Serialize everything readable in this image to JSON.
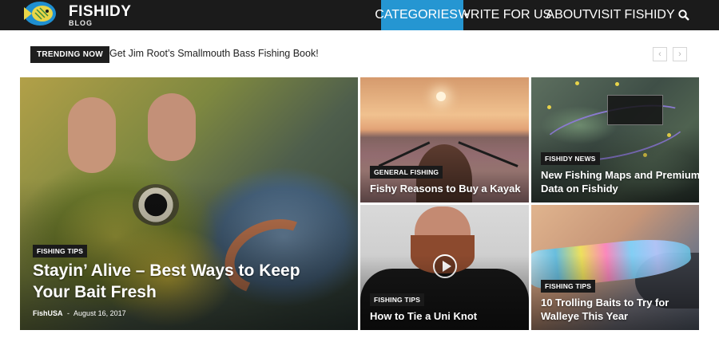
{
  "header": {
    "brand_name": "FISHIDY",
    "brand_sub": "BLOG",
    "nav": {
      "categories": "CATEGORIES",
      "write_for_us": "WRITE FOR US",
      "about": "ABOUT",
      "visit_fishidy": "VISIT FISHIDY"
    },
    "accent_color": "#2596d2"
  },
  "trending": {
    "label": "TRENDING NOW",
    "title": "Get Jim Root’s Smallmouth Bass Fishing Book!",
    "prev_glyph": "‹",
    "next_glyph": "›"
  },
  "featured": {
    "category": "FISHING TIPS",
    "title_line1": "Stayin’ Alive – Best Ways to Keep",
    "title_line2": "Your Bait Fresh",
    "author": "FishUSA",
    "separator": "-",
    "date": "August 16, 2017"
  },
  "tiles": [
    {
      "category": "GENERAL FISHING",
      "title_line1": "Fishy Reasons to Buy a Kayak",
      "title_line2": ""
    },
    {
      "category": "FISHIDY NEWS",
      "title_line1": "New Fishing Maps and Premium",
      "title_line2": "Data on Fishidy"
    },
    {
      "category": "FISHING TIPS",
      "title_line1": "How to Tie a Uni Knot",
      "title_line2": ""
    },
    {
      "category": "FISHING TIPS",
      "title_line1": "10 Trolling Baits to Try for",
      "title_line2": "Walleye This Year"
    }
  ]
}
